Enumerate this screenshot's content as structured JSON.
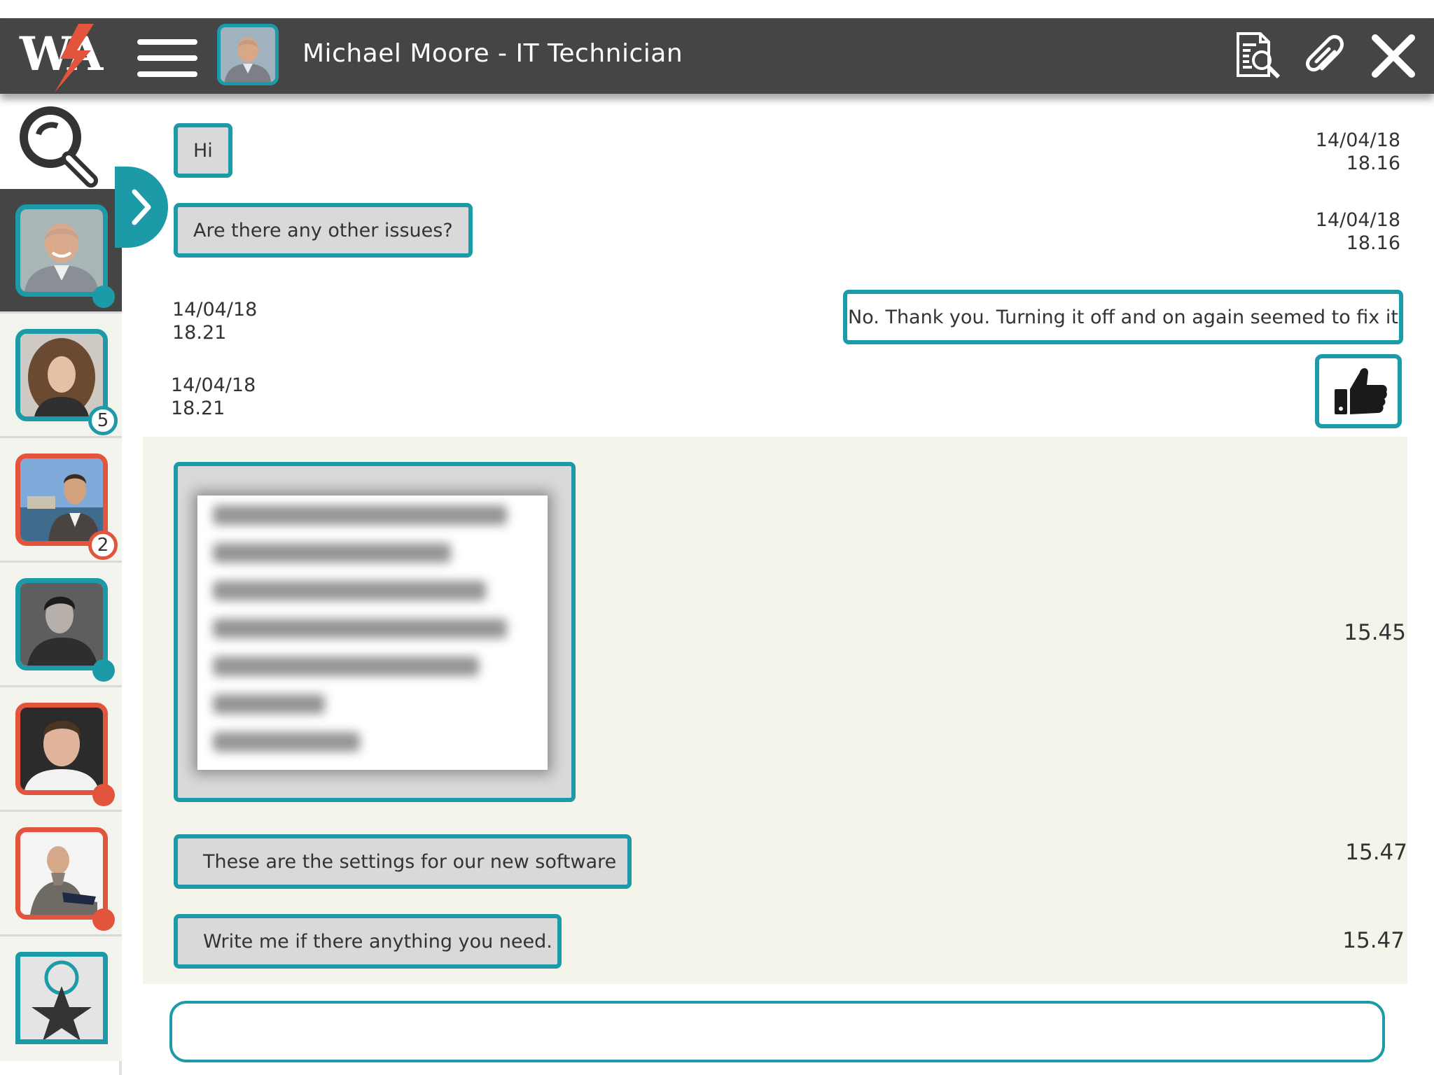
{
  "header": {
    "title": "Michael Moore - IT Technician",
    "logo_text": "WA",
    "icons": [
      "logo-icon",
      "menu-icon",
      "search-document-icon",
      "paperclip-icon",
      "close-icon"
    ]
  },
  "sidebar": {
    "contacts": [
      {
        "name": "contact-michael",
        "border": "teal",
        "status": "online",
        "active": true
      },
      {
        "name": "contact-woman-curly",
        "border": "teal",
        "badge": "5"
      },
      {
        "name": "contact-man-suit",
        "border": "red",
        "badge": "2"
      },
      {
        "name": "contact-man-dark",
        "border": "teal",
        "status": "online"
      },
      {
        "name": "contact-young-man",
        "border": "red",
        "status": "offline"
      },
      {
        "name": "contact-bald-man",
        "border": "red",
        "status": "offline"
      },
      {
        "name": "favorites",
        "icon": "star-icon"
      }
    ]
  },
  "chat": {
    "messages": [
      {
        "text": "Hi",
        "date": "14/04/18",
        "time": "18.16"
      },
      {
        "text": "Are there any other issues?",
        "date": "14/04/18",
        "time": "18.16"
      },
      {
        "text": "No. Thank you. Turning it off and on again seemed to fix it",
        "date": "14/04/18",
        "time": "18.21"
      },
      {
        "icon": "thumbs-up-icon",
        "date": "14/04/18",
        "time": "18.21"
      },
      {
        "attachment": "image",
        "time": "15.45"
      },
      {
        "text": "These are the settings for our new software",
        "time": "15.47"
      },
      {
        "text": "Write me if there anything you need.",
        "time": "15.47"
      }
    ]
  },
  "composer": {
    "value": "",
    "placeholder": ""
  },
  "colors": {
    "accent": "#1c9aa8",
    "alert": "#e2543c",
    "header": "#454545",
    "panel": "#f4f4ea",
    "bubble": "#d9d9d9"
  }
}
